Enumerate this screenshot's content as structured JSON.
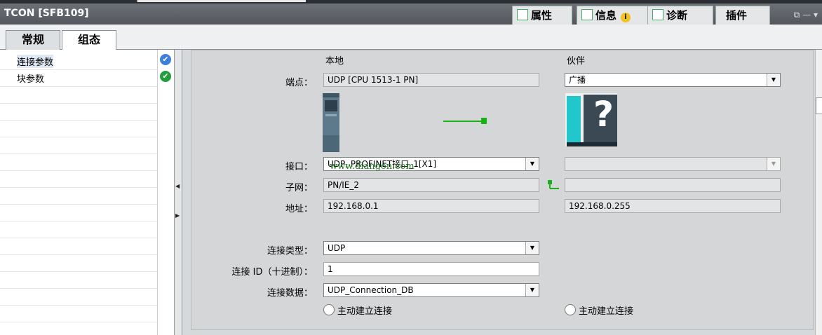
{
  "window": {
    "title": "TCON [SFB109]",
    "controls": "⧉ — ▾"
  },
  "inspector_tabs": [
    {
      "label": "属性",
      "icon": "properties-icon"
    },
    {
      "label": "信息",
      "icon": "info-list-icon"
    },
    {
      "label": "诊断",
      "icon": "diagnostics-icon"
    },
    {
      "label": "插件",
      "icon": ""
    }
  ],
  "subtabs": [
    "常规",
    "组态"
  ],
  "nav": [
    {
      "label": "连接参数",
      "status_color": "#3d7fdc",
      "glyph": "✔"
    },
    {
      "label": "块参数",
      "status_color": "#1f9e3a",
      "glyph": "✔"
    }
  ],
  "headers": {
    "local": "本地",
    "partner": "伙伴"
  },
  "labels": {
    "endpoint": "端点：",
    "interface": "接口：",
    "subnet": "子网：",
    "address": "地址：",
    "conn_type": "连接类型：",
    "conn_id": "连接 ID（十进制）：",
    "conn_data": "连接数据："
  },
  "local": {
    "endpoint": "UDP [CPU 1513-1 PN]",
    "interface": "UDP, PROFINET接口_1[X1]",
    "subnet": "PN/IE_2",
    "address": "192.168.0.1"
  },
  "partner": {
    "endpoint": "广播",
    "interface": "",
    "subnet": "",
    "address": "192.168.0.255",
    "unknown_glyph": "?"
  },
  "connection": {
    "type": "UDP",
    "id": "1",
    "data": "UDP_Connection_DB"
  },
  "radio_local": "主动建立连接",
  "radio_partner": "主动建立连接",
  "watermark": "www.diangon.com",
  "colors": {
    "title_bg": "#5f6369",
    "check_blue": "#3d7fdc",
    "check_green": "#1f9e3a",
    "link_green": "#17b217"
  }
}
